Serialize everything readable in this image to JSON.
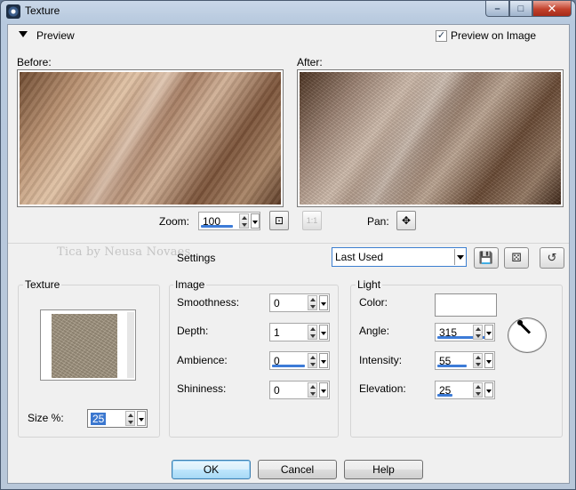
{
  "window": {
    "title": "Texture",
    "controls": {
      "minimize": "–",
      "maximize": "□",
      "close": "✕"
    }
  },
  "preview": {
    "heading": "Preview",
    "preview_on_image_label": "Preview on Image",
    "preview_on_image_checked": true,
    "before_label": "Before:",
    "after_label": "After:",
    "zoom_label": "Zoom:",
    "zoom_value": "100",
    "pan_label": "Pan:",
    "one_to_one": "1:1"
  },
  "settings": {
    "watermark": "Tica by Neusa Novaes",
    "label": "Settings",
    "preset_value": "Last Used"
  },
  "texture_group": {
    "title": "Texture",
    "size_label": "Size %:",
    "size_value": "25",
    "swatch_color": "#a89b85"
  },
  "image_group": {
    "title": "Image",
    "smoothness_label": "Smoothness:",
    "smoothness_value": "0",
    "depth_label": "Depth:",
    "depth_value": "1",
    "ambience_label": "Ambience:",
    "ambience_value": "0",
    "shininess_label": "Shininess:",
    "shininess_value": "0"
  },
  "light_group": {
    "title": "Light",
    "color_label": "Color:",
    "color_value": "#ffffff",
    "angle_label": "Angle:",
    "angle_value": "315",
    "intensity_label": "Intensity:",
    "intensity_value": "55",
    "elevation_label": "Elevation:",
    "elevation_value": "25"
  },
  "buttons": {
    "ok": "OK",
    "cancel": "Cancel",
    "help": "Help"
  },
  "icons": {
    "app": "texture-app-icon",
    "zoom_fit": "zoom-fit-icon",
    "pan": "pan-move-icon",
    "save_preset": "save-preset-icon",
    "randomize": "randomize-dice-icon",
    "reset": "reset-icon"
  }
}
